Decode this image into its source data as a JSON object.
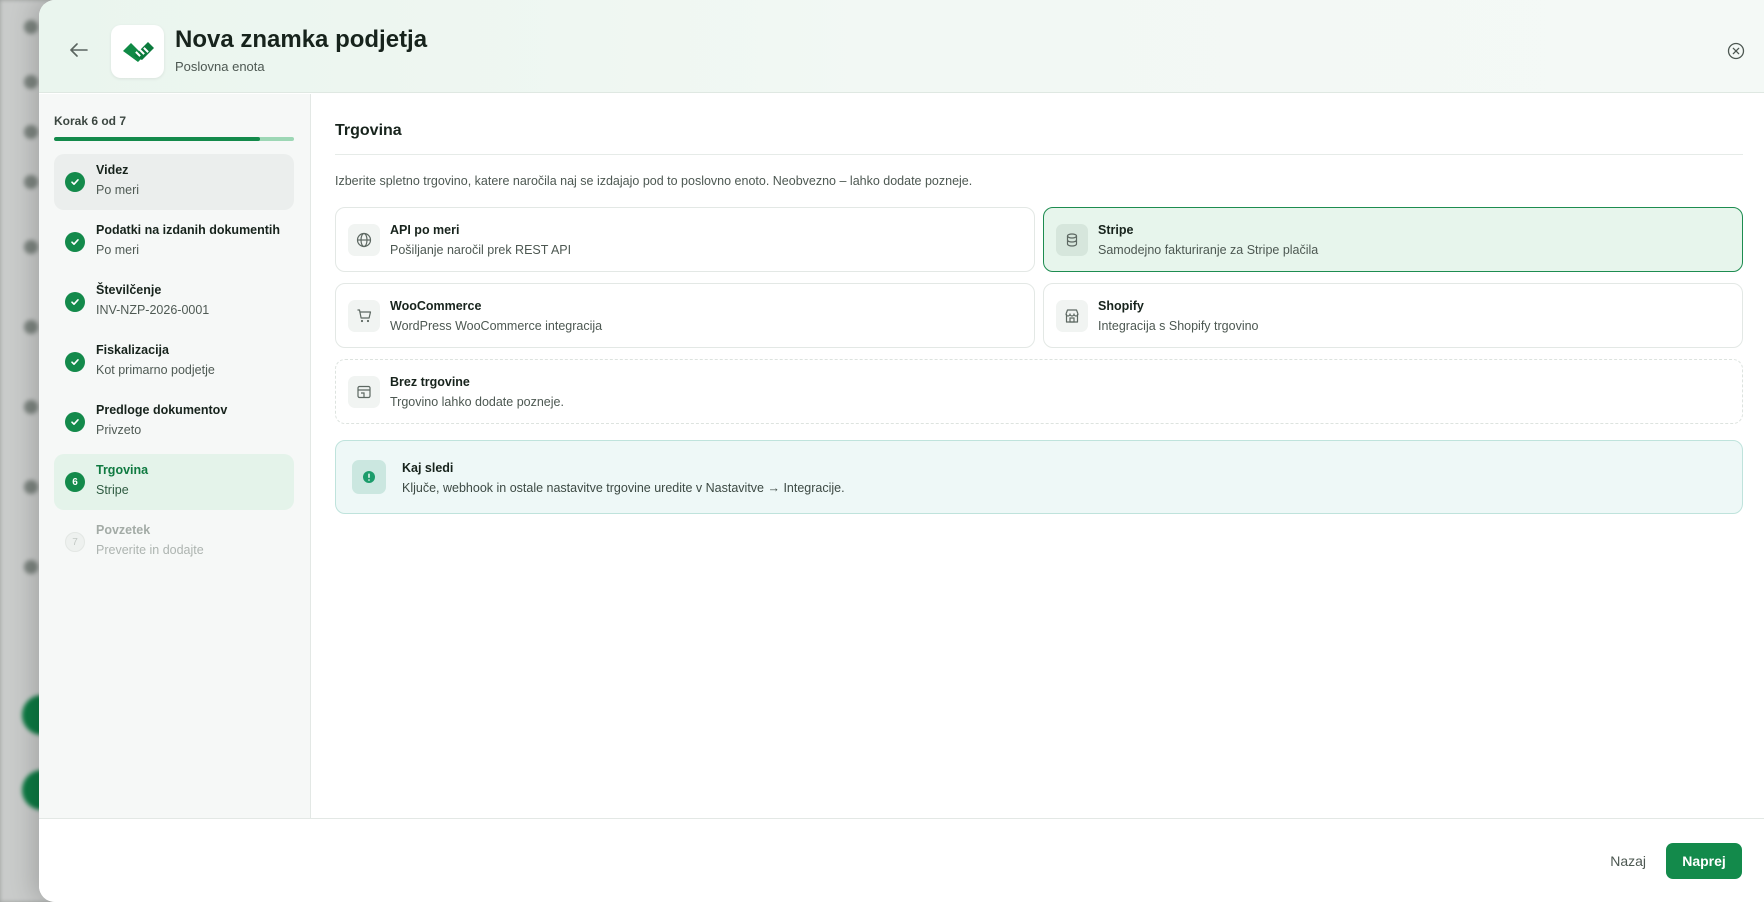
{
  "header": {
    "title": "Nova znamka podjetja",
    "subtitle": "Poslovna enota"
  },
  "sidebar": {
    "step_count": "Korak 6 od 7",
    "progress": 0.86,
    "steps": [
      {
        "title": "Videz",
        "sub": "Po meri",
        "status": "done"
      },
      {
        "title": "Podatki na izdanih dokumentih",
        "sub": "Po meri",
        "status": "done"
      },
      {
        "title": "Številčenje",
        "sub": "INV-NZP-2026-0001",
        "status": "done"
      },
      {
        "title": "Fiskalizacija",
        "sub": "Kot primarno podjetje",
        "status": "done"
      },
      {
        "title": "Predloge dokumentov",
        "sub": "Privzeto",
        "status": "done"
      },
      {
        "title": "Trgovina",
        "sub": "Stripe",
        "status": "current",
        "number": "6"
      },
      {
        "title": "Povzetek",
        "sub": "Preverite in dodajte",
        "status": "pending",
        "number": "7"
      }
    ]
  },
  "main": {
    "section_title": "Trgovina",
    "description": "Izberite spletno trgovino, katere naročila naj se izdajajo pod to poslovno enoto. Neobvezno – lahko dodate pozneje.",
    "options": [
      {
        "title": "API po meri",
        "sub": "Pošiljanje naročil prek REST API",
        "icon": "globe-icon",
        "selected": false
      },
      {
        "title": "Stripe",
        "sub": "Samodejno fakturiranje za Stripe plačila",
        "icon": "coins-icon",
        "selected": true
      },
      {
        "title": "WooCommerce",
        "sub": "WordPress WooCommerce integracija",
        "icon": "cart-icon",
        "selected": false
      },
      {
        "title": "Shopify",
        "sub": "Integracija s Shopify trgovino",
        "icon": "store-icon",
        "selected": false
      },
      {
        "title": "Brez trgovine",
        "sub": "Trgovino lahko dodate pozneje.",
        "icon": "no-store-icon",
        "selected": false
      }
    ],
    "info": {
      "title": "Kaj sledi",
      "text": "Ključe, webhook in ostale nastavitve trgovine uredite v Nastavitve → Integracije."
    }
  },
  "footer": {
    "back_label": "Nazaj",
    "next_label": "Naprej"
  },
  "colors": {
    "accent": "#138a4b",
    "selected_bg": "#e7f5ec",
    "info_bg": "#eef8f7"
  }
}
